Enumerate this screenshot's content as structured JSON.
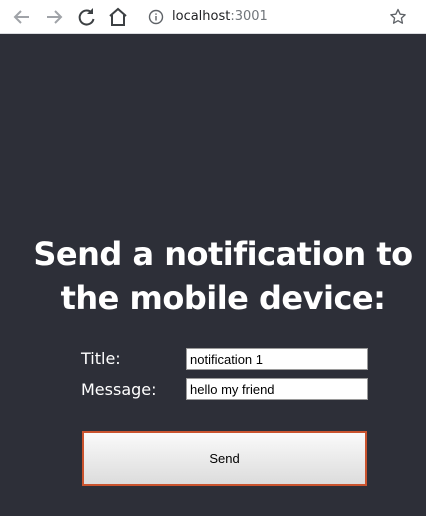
{
  "browser": {
    "url_host": "localhost",
    "url_port": ":3001",
    "icons": [
      "back-arrow-icon",
      "forward-arrow-icon",
      "reload-icon",
      "home-icon",
      "info-icon",
      "star-icon"
    ]
  },
  "page": {
    "heading": "Send a notification to the mobile device:",
    "title_label": "Title:",
    "message_label": "Message:",
    "title_value": "notification 1",
    "message_value": "hello my friend",
    "send_label": "Send"
  },
  "colors": {
    "background": "#2d2f38",
    "button_border": "#c9532e"
  }
}
